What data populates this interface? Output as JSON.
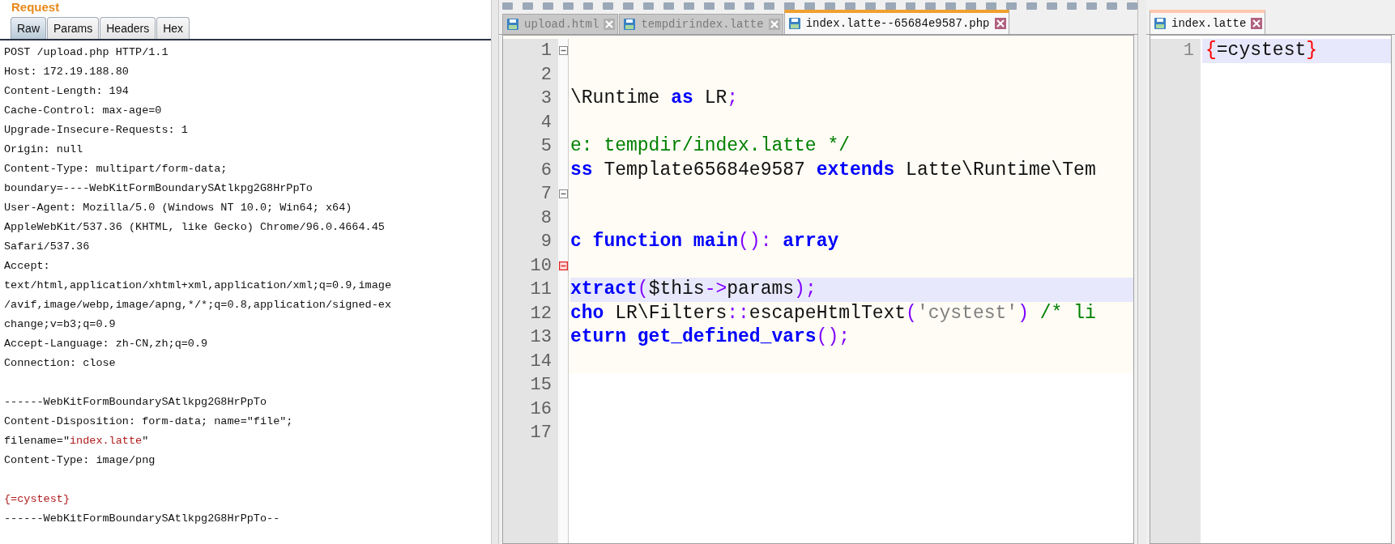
{
  "request": {
    "title": "Request",
    "tabs": [
      {
        "label": "Raw",
        "selected": true
      },
      {
        "label": "Params",
        "selected": false
      },
      {
        "label": "Headers",
        "selected": false
      },
      {
        "label": "Hex",
        "selected": false
      }
    ],
    "sections": [
      {
        "lines": [
          [
            {
              "text": "POST /upload.php HTTP/1.1",
              "kind": "plain"
            }
          ],
          [
            {
              "text": "Host: 172.19.188.80",
              "kind": "plain"
            }
          ],
          [
            {
              "text": "Content-Length: 194",
              "kind": "plain"
            }
          ],
          [
            {
              "text": "Cache-Control: max-age=0",
              "kind": "plain"
            }
          ],
          [
            {
              "text": "Upgrade-Insecure-Requests: 1",
              "kind": "plain"
            }
          ],
          [
            {
              "text": "Origin: null",
              "kind": "plain"
            }
          ],
          [
            {
              "text": "Content-Type: multipart/form-data;",
              "kind": "plain"
            }
          ],
          [
            {
              "text": "boundary=----WebKitFormBoundarySAtlkpg2G8HrPpTo",
              "kind": "plain"
            }
          ],
          [
            {
              "text": "User-Agent: Mozilla/5.0 (Windows NT 10.0; Win64; x64)",
              "kind": "plain"
            }
          ],
          [
            {
              "text": "AppleWebKit/537.36 (KHTML, like Gecko) Chrome/96.0.4664.45",
              "kind": "plain"
            }
          ],
          [
            {
              "text": "Safari/537.36",
              "kind": "plain"
            }
          ],
          [
            {
              "text": "Accept:",
              "kind": "plain"
            }
          ],
          [
            {
              "text": "text/html,application/xhtml+xml,application/xml;q=0.9,image",
              "kind": "plain"
            }
          ],
          [
            {
              "text": "/avif,image/webp,image/apng,*/*;q=0.8,application/signed-ex",
              "kind": "plain"
            }
          ],
          [
            {
              "text": "change;v=b3;q=0.9",
              "kind": "plain"
            }
          ],
          [
            {
              "text": "Accept-Language: zh-CN,zh;q=0.9",
              "kind": "plain"
            }
          ],
          [
            {
              "text": "Connection: close",
              "kind": "plain"
            }
          ]
        ]
      },
      {
        "lines": [
          [
            {
              "text": "------WebKitFormBoundarySAtlkpg2G8HrPpTo",
              "kind": "plain"
            }
          ],
          [
            {
              "text": "Content-Disposition: form-data; name=\"file\";",
              "kind": "plain"
            }
          ],
          [
            {
              "text": "filename=\"",
              "kind": "plain"
            },
            {
              "text": "index.latte",
              "kind": "value"
            },
            {
              "text": "\"",
              "kind": "plain"
            }
          ],
          [
            {
              "text": "Content-Type: image/png",
              "kind": "plain"
            }
          ]
        ]
      },
      {
        "lines": [
          [
            {
              "text": "{=cystest}",
              "kind": "value"
            }
          ],
          [
            {
              "text": "------WebKitFormBoundarySAtlkpg2G8HrPpTo--",
              "kind": "plain"
            }
          ]
        ]
      }
    ]
  },
  "editor": {
    "tabs": [
      {
        "label": "upload.html",
        "selected": false
      },
      {
        "label": "tempdirindex.latte",
        "selected": false
      },
      {
        "label": "index.latte--65684e9587.php",
        "selected": true
      }
    ],
    "lines": [
      {
        "number": "1",
        "fold_marker": true,
        "fold_active": false,
        "current": false
      },
      {
        "number": "2",
        "fold_marker": false,
        "current": false
      },
      {
        "number": "3",
        "fold_marker": false,
        "current": false,
        "tokens": [
          {
            "text": "\\Runtime ",
            "kind": "plain"
          },
          {
            "text": "as",
            "kind": "keyword"
          },
          {
            "text": " LR",
            "kind": "plain"
          },
          {
            "text": ";",
            "kind": "op"
          }
        ]
      },
      {
        "number": "4",
        "fold_marker": false,
        "current": false
      },
      {
        "number": "5",
        "fold_marker": false,
        "current": false,
        "tokens": [
          {
            "text": "e: tempdir/index.latte */",
            "kind": "comment"
          }
        ]
      },
      {
        "number": "6",
        "fold_marker": false,
        "current": false,
        "tokens": [
          {
            "text": "ss",
            "kind": "keyword"
          },
          {
            "text": " Template65684e9587 ",
            "kind": "plain"
          },
          {
            "text": "extends",
            "kind": "keyword"
          },
          {
            "text": " Latte\\Runtime\\Tem",
            "kind": "plain"
          }
        ]
      },
      {
        "number": "7",
        "fold_marker": true,
        "fold_active": false,
        "current": false
      },
      {
        "number": "8",
        "fold_marker": false,
        "current": false
      },
      {
        "number": "9",
        "fold_marker": false,
        "current": false,
        "tokens": [
          {
            "text": "c function main",
            "kind": "keyword"
          },
          {
            "text": "():",
            "kind": "op"
          },
          {
            "text": " array",
            "kind": "keyword"
          }
        ]
      },
      {
        "number": "10",
        "fold_marker": true,
        "fold_active": true,
        "current": false
      },
      {
        "number": "11",
        "fold_marker": false,
        "current": true,
        "tokens": [
          {
            "text": "xtract",
            "kind": "keyword"
          },
          {
            "text": "(",
            "kind": "op"
          },
          {
            "text": "$this",
            "kind": "plain"
          },
          {
            "text": "->",
            "kind": "op"
          },
          {
            "text": "params",
            "kind": "plain"
          },
          {
            "text": ");",
            "kind": "op"
          }
        ]
      },
      {
        "number": "12",
        "fold_marker": false,
        "current": false,
        "tokens": [
          {
            "text": "cho",
            "kind": "keyword"
          },
          {
            "text": " LR\\Filters",
            "kind": "plain"
          },
          {
            "text": "::",
            "kind": "op"
          },
          {
            "text": "escapeHtmlText",
            "kind": "plain"
          },
          {
            "text": "(",
            "kind": "op"
          },
          {
            "text": "'cystest'",
            "kind": "string"
          },
          {
            "text": ")",
            "kind": "op"
          },
          {
            "text": " /* li",
            "kind": "comment"
          }
        ]
      },
      {
        "number": "13",
        "fold_marker": false,
        "current": false,
        "tokens": [
          {
            "text": "eturn get_defined_vars",
            "kind": "keyword"
          },
          {
            "text": "();",
            "kind": "op"
          }
        ]
      },
      {
        "number": "14",
        "fold_marker": false,
        "current": false
      },
      {
        "number": "15",
        "fold_marker": false,
        "current": false
      },
      {
        "number": "16",
        "fold_marker": false,
        "current": false
      },
      {
        "number": "17",
        "fold_marker": false,
        "current": false
      }
    ]
  },
  "side_editor": {
    "tabs": [
      {
        "label": "index.latte",
        "selected": true
      }
    ],
    "lines": [
      {
        "number": "1",
        "current": true,
        "tokens": [
          {
            "text": "{",
            "kind": "brace"
          },
          {
            "text": "=cystest",
            "kind": "plain"
          },
          {
            "text": "}",
            "kind": "brace"
          }
        ]
      }
    ]
  }
}
